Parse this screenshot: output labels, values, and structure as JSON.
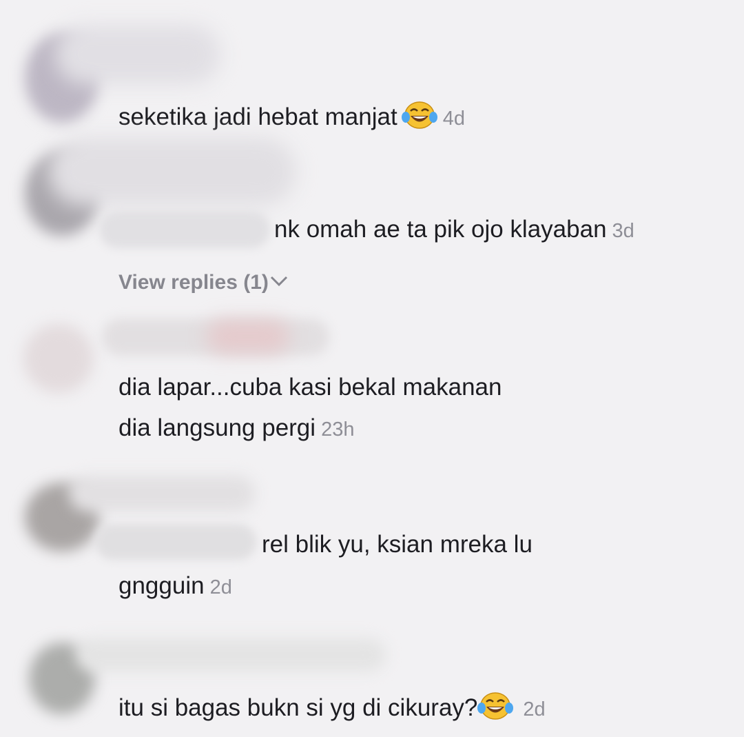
{
  "comments": [
    {
      "text": "seketika jadi hebat manjat",
      "emoji": "laughing-tears-emoji",
      "time": "4d"
    },
    {
      "text": "nk omah ae ta pik ojo klayaban",
      "time": "3d",
      "view_replies": "View replies (1)"
    },
    {
      "line1": "dia lapar...cuba kasi bekal makanan",
      "line2": "dia langsung pergi",
      "time": "23h"
    },
    {
      "line1": "rel blik yu, ksian mreka lu",
      "line2": "gngguin",
      "time": "2d"
    },
    {
      "text": "itu si bagas bukn si yg di cikuray?",
      "emoji": "laughing-tears-emoji",
      "time": "2d"
    }
  ],
  "colors": {
    "background": "#f2f1f3",
    "text": "#1d1d22",
    "timestamp": "#8e8e96",
    "view_replies": "#86868e"
  }
}
